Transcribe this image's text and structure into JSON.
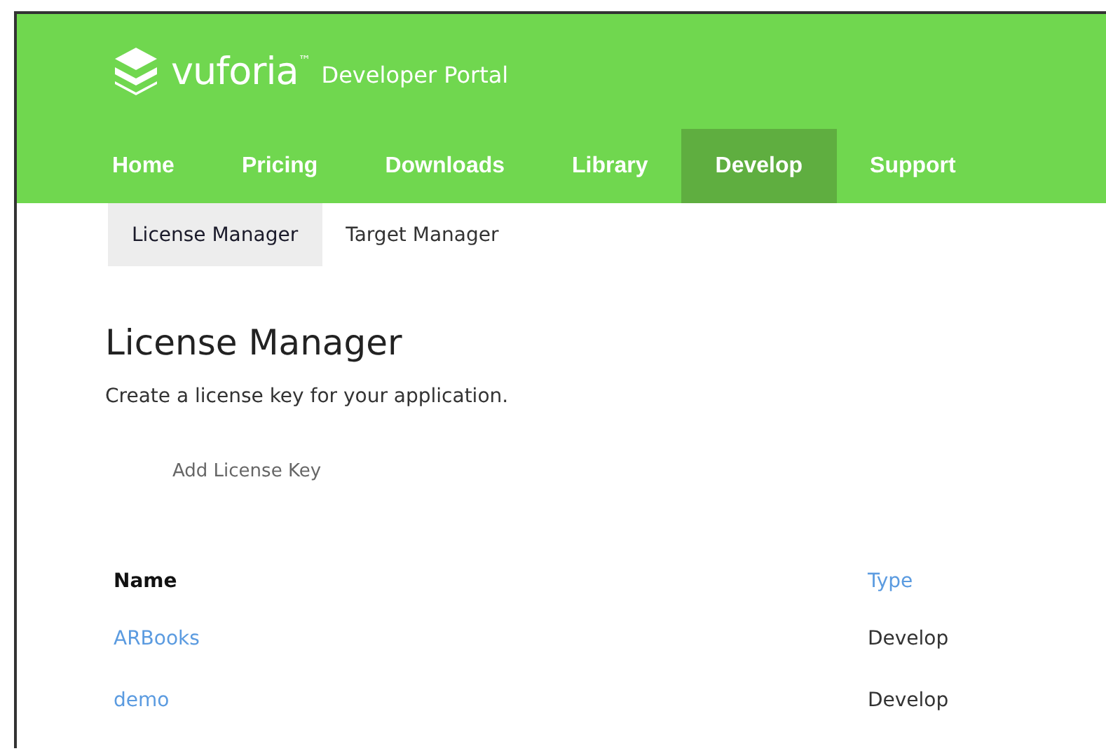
{
  "brand": {
    "name": "vuforia$^{™}$",
    "tagline": "Developer Portal"
  },
  "nav": [
    {
      "label": "Home",
      "selected": false
    },
    {
      "label": "Pricing",
      "selected": false
    },
    {
      "label": "Downloads",
      "selected": false
    },
    {
      "label": "Library",
      "selected": false
    },
    {
      "label": "Develop",
      "selected": true
    },
    {
      "label": "Support",
      "selected": false
    }
  ],
  "subnav": [
    {
      "label": "License Manager",
      "selected": true
    },
    {
      "label": "Target Manager",
      "selected": false
    }
  ],
  "heading": "License Manager",
  "description": "Create a license key for your application.",
  "add_button": "Add License Key",
  "table": {
    "columns": [
      {
        "label": "Name",
        "kind": "plain"
      },
      {
        "label": "Type",
        "kind": "link"
      }
    ],
    "rows": [
      {
        "name": "ARBooks",
        "type": "Develop"
      },
      {
        "name": "demo",
        "type": "Develop"
      }
    ]
  }
}
